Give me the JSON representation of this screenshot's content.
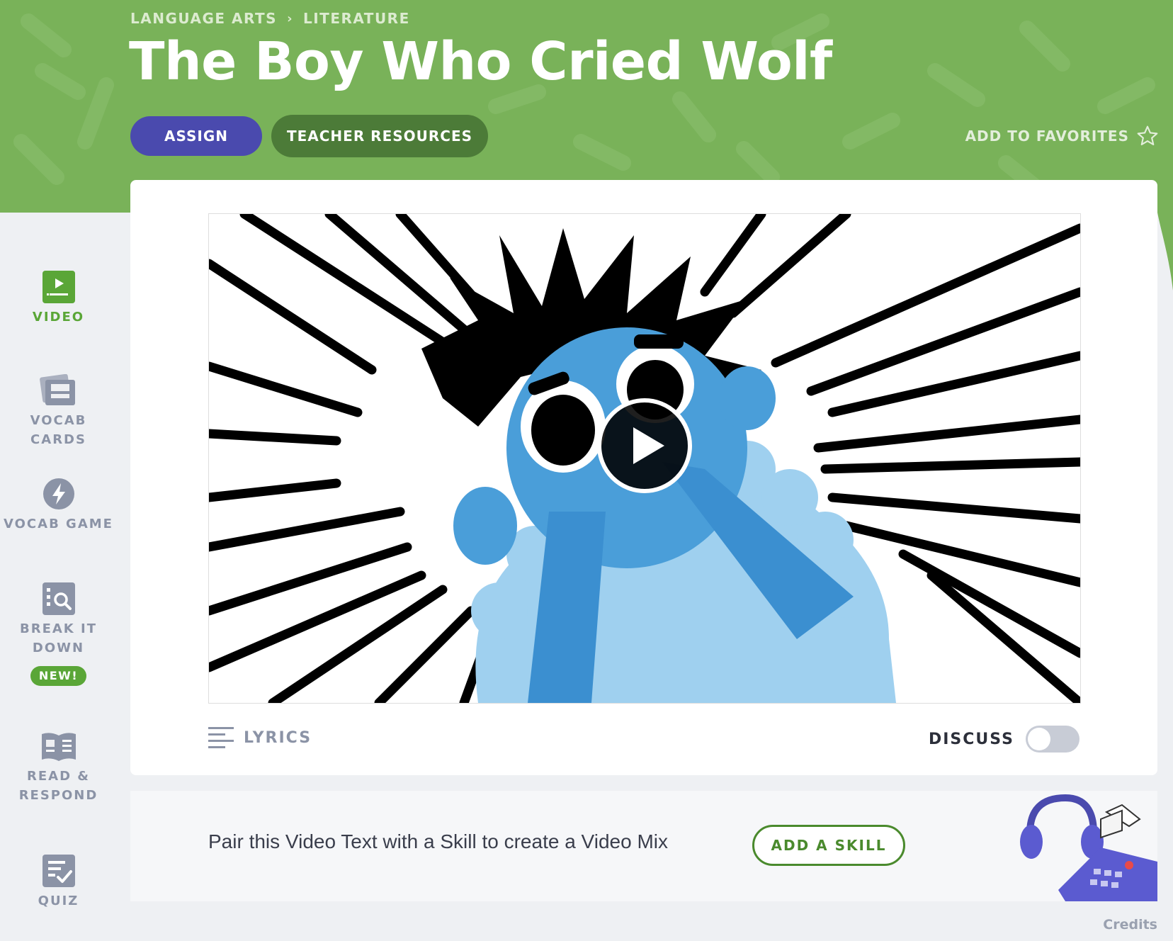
{
  "breadcrumb": {
    "items": [
      "LANGUAGE ARTS",
      "LITERATURE"
    ],
    "separator": "›"
  },
  "page": {
    "title": "The Boy Who Cried Wolf"
  },
  "actions": {
    "assign_label": "ASSIGN",
    "teacher_resources_label": "TEACHER RESOURCES",
    "favorites_label": "ADD TO FAVORITES"
  },
  "sidebar": {
    "items": [
      {
        "label": "VIDEO",
        "icon": "video-icon",
        "active": true
      },
      {
        "label": "VOCAB CARDS",
        "icon": "vocab-cards-icon",
        "active": false
      },
      {
        "label": "VOCAB GAME",
        "icon": "lightning-icon",
        "active": false
      },
      {
        "label": "BREAK IT DOWN",
        "icon": "magnifier-icon",
        "active": false,
        "badge": "NEW!"
      },
      {
        "label": "READ & RESPOND",
        "icon": "book-icon",
        "active": false
      },
      {
        "label": "QUIZ",
        "icon": "quiz-icon",
        "active": false
      }
    ]
  },
  "video": {
    "lyrics_label": "LYRICS",
    "discuss_label": "DISCUSS",
    "discuss_on": false
  },
  "mix": {
    "text": "Pair this Video Text with a Skill to create a Video Mix",
    "button_label": "ADD A SKILL"
  },
  "footer": {
    "credits": "Credits"
  },
  "colors": {
    "header_green": "#79b259",
    "assign_purple": "#4a4aae",
    "teacher_green": "#4c7b38",
    "active_green": "#5aa637",
    "sidebar_gray": "#8b93a6"
  }
}
